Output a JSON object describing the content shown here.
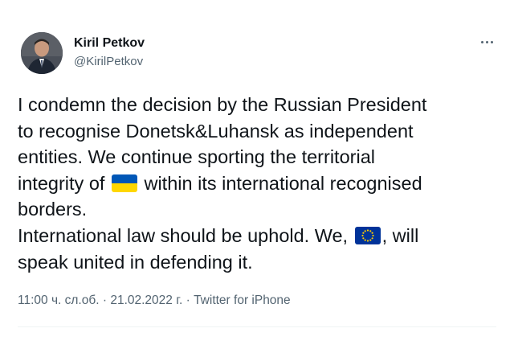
{
  "author": {
    "name": "Kiril Petkov",
    "handle": "@KirilPetkov",
    "avatar_icon": "profile-photo"
  },
  "more_icon": "more-horizontal-icon",
  "tweet": {
    "line1": "I condemn the decision by the Russian President",
    "line2": "to recognise Donetsk&Luhansk as independent",
    "line3": "entities. We continue sporting the territorial",
    "line4_before": "integrity of ",
    "line4_flag": "flag-ukraine-icon",
    "line4_after": " within its international recognised",
    "line5": "borders.",
    "line6_before": "International law should be uphold. We, ",
    "line6_flag": "flag-eu-icon",
    "line6_after": ", will",
    "line7": "speak united in defending it."
  },
  "meta": {
    "time": "11:00 ч. сл.об.",
    "separator1": " · ",
    "date": "21.02.2022 г.",
    "separator2": " · ",
    "source": "Twitter for iPhone"
  },
  "colors": {
    "text": "#0f1419",
    "secondary": "#536471",
    "ukraine_blue": "#0057b7",
    "ukraine_yellow": "#ffd700",
    "eu_blue": "#003399",
    "eu_star": "#ffcc00"
  }
}
